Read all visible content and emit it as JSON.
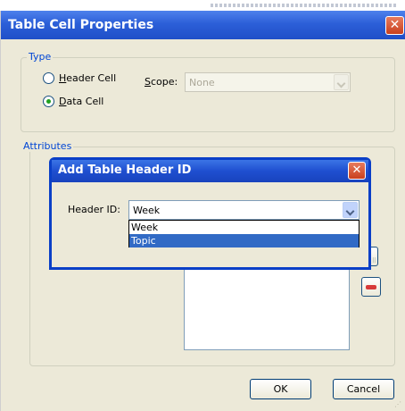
{
  "window": {
    "title": "Table Cell Properties",
    "close_glyph": "✕"
  },
  "type_group": {
    "legend": "Type",
    "header_cell": {
      "prefix": "",
      "mnemonic": "H",
      "rest": "eader Cell",
      "checked": false
    },
    "data_cell": {
      "prefix": "",
      "mnemonic": "D",
      "rest": "ata Cell",
      "checked": true
    },
    "scope": {
      "mnemonic": "S",
      "rest": "cope:",
      "value": "None",
      "disabled": true
    }
  },
  "attributes_group": {
    "legend": "Attributes"
  },
  "footer": {
    "ok_label": "OK",
    "cancel_label": "Cancel"
  },
  "sub_dialog": {
    "title": "Add Table Header ID",
    "close_glyph": "✕",
    "header_id_label": "Header ID:",
    "header_id_value": "Week",
    "options": [
      "Week",
      "Topic"
    ],
    "highlighted_option": "Topic"
  },
  "colors": {
    "title_blue": "#2c5fd8",
    "legend_blue": "#0046d5",
    "selection": "#316ac5",
    "close_red": "#c9401e"
  }
}
